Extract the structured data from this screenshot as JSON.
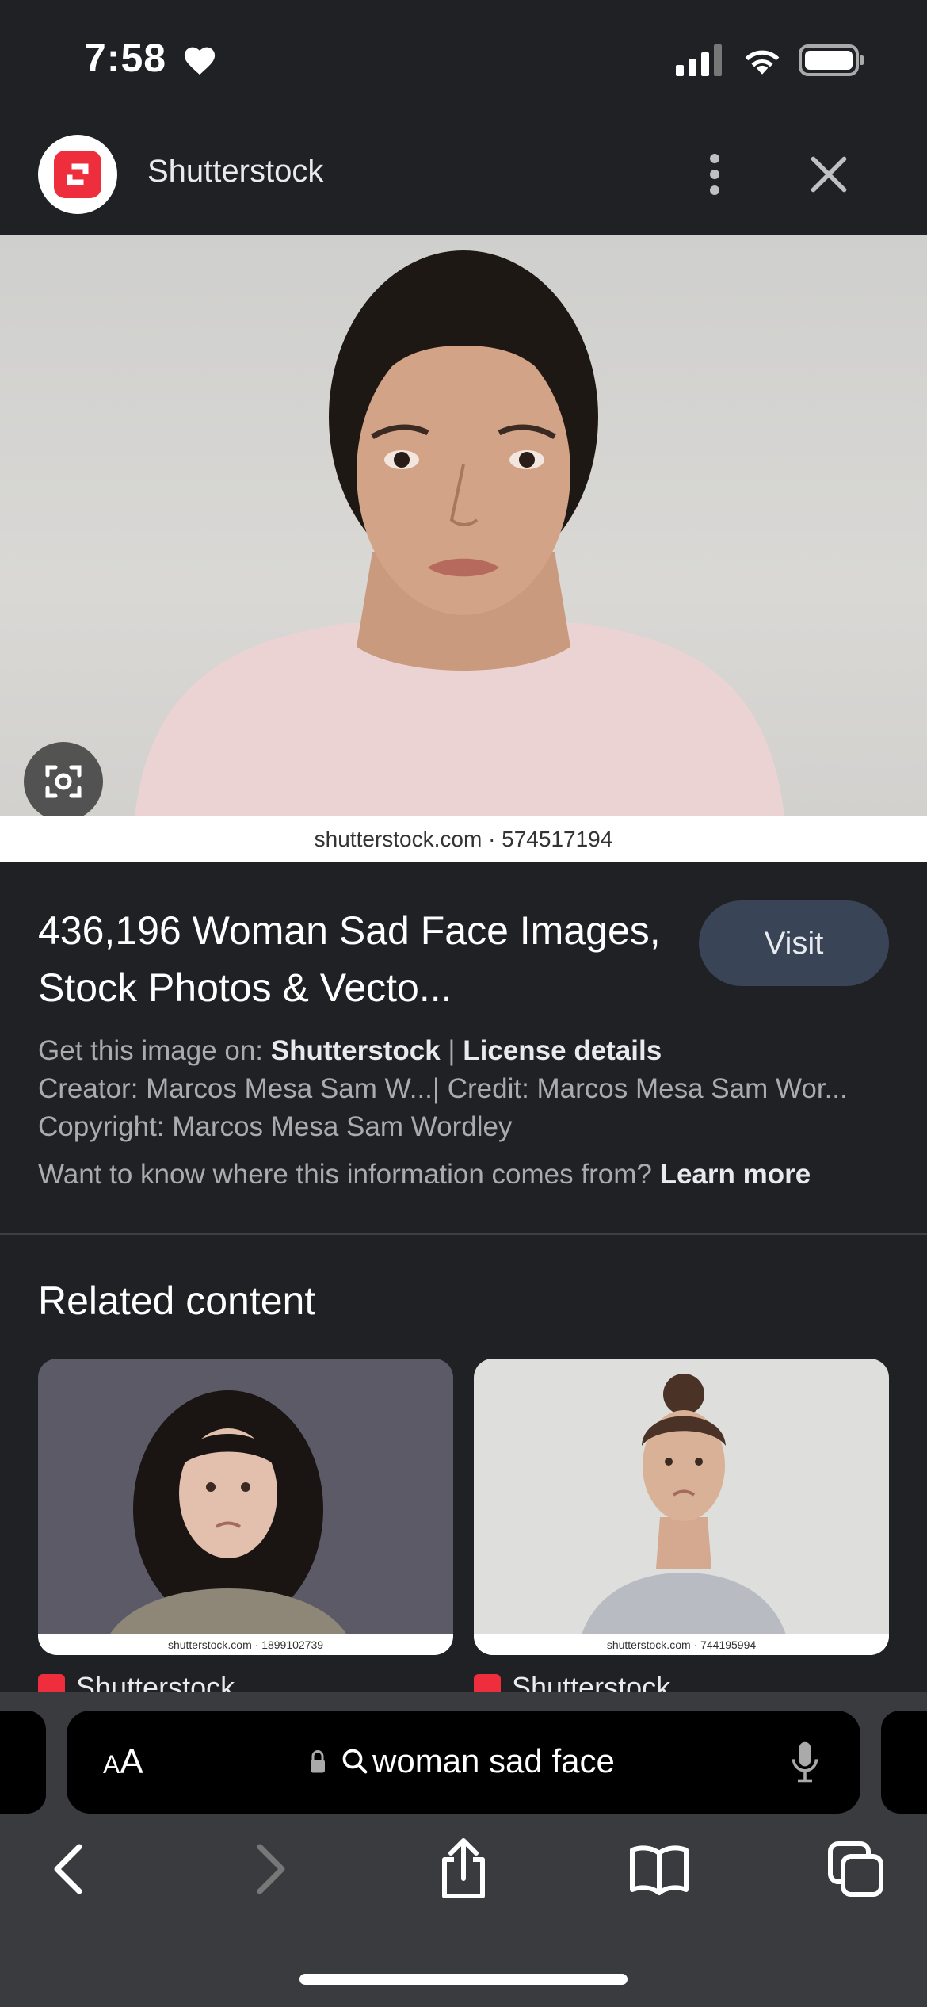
{
  "status_bar": {
    "time": "7:58"
  },
  "site": {
    "name": "Shutterstock"
  },
  "hero": {
    "caption": "shutterstock.com · 574517194"
  },
  "result": {
    "title": "436,196 Woman Sad Face Images, Stock Photos & Vecto...",
    "visit_label": "Visit",
    "get_image_prefix": "Get this image on: ",
    "get_image_source": "Shutterstock",
    "separator": " | ",
    "license_details": "License details",
    "creator_credit": "Creator: Marcos Mesa Sam W...| Credit: Marcos Mesa Sam Wor...",
    "copyright": "Copyright: Marcos Mesa Sam Wordley",
    "info_question": "Want to know where this information comes from? ",
    "learn_more": "Learn more"
  },
  "related": {
    "heading": "Related content",
    "cards": [
      {
        "caption": "shutterstock.com · 1899102739",
        "source": "Shutterstock"
      },
      {
        "caption": "shutterstock.com · 744195994",
        "source": "Shutterstock"
      }
    ]
  },
  "browser": {
    "text_size_label_small": "A",
    "text_size_label_large": "A",
    "address_text": "woman sad face"
  },
  "colors": {
    "accent": "#ee2e3c",
    "visit_bg": "#394457",
    "background": "#202124"
  },
  "icons": [
    "heart-icon",
    "signal-icon",
    "wifi-icon",
    "battery-icon",
    "more-vert-icon",
    "close-icon",
    "lens-icon",
    "lock-icon",
    "search-icon",
    "mic-icon",
    "back-icon",
    "forward-icon",
    "share-icon",
    "bookmarks-icon",
    "tabs-icon"
  ]
}
